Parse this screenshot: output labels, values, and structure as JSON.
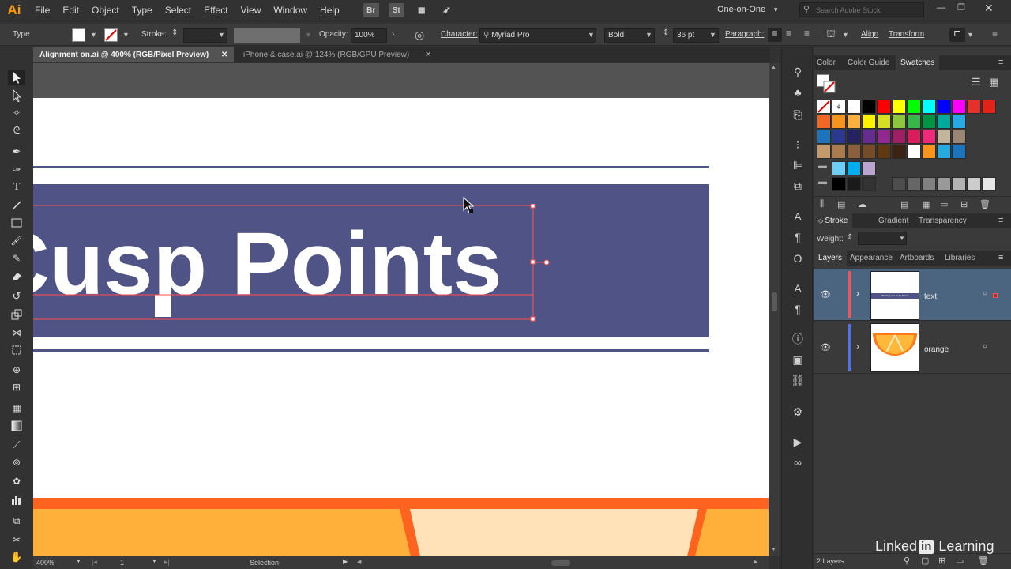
{
  "app": {
    "logo": "Ai"
  },
  "menu": [
    "File",
    "Edit",
    "Object",
    "Type",
    "Select",
    "Effect",
    "View",
    "Window",
    "Help"
  ],
  "menubar_icons": {
    "bridge": "Br",
    "stock": "St"
  },
  "workspace": "One-on-One",
  "stock_search_placeholder": "Search Adobe Stock",
  "control": {
    "type_label": "Type",
    "stroke_label": "Stroke:",
    "opacity_label": "Opacity:",
    "opacity_value": "100%",
    "character_label": "Character:",
    "font_family": "Myriad Pro",
    "font_style": "Bold",
    "font_size": "36 pt",
    "paragraph_label": "Paragraph:",
    "align_label": "Align",
    "transform_label": "Transform"
  },
  "tabs": [
    {
      "label": "Alignment on.ai @ 400% (RGB/Pixel Preview)",
      "active": true
    },
    {
      "label": "iPhone & case.ai @ 124% (RGB/GPU Preview)",
      "active": false
    }
  ],
  "artboard": {
    "headline": "Cusp Points",
    "banner_color": "#505385",
    "orange_outer": "#ff6320",
    "orange_inner": "#ffb03a",
    "orange_light": "#ffe2b8"
  },
  "status": {
    "zoom": "400%",
    "artboard_number": "1",
    "tool": "Selection"
  },
  "color_panel": {
    "tabs": [
      "Color",
      "Color Guide",
      "Swatches"
    ],
    "active_tab": "Swatches",
    "swatch_rows": [
      [
        "#ffffff",
        "#000000",
        "#ff0000",
        "#ffff00",
        "#00ff00",
        "#00ffff",
        "#0000ff",
        "#ff00ff",
        "#e6302c",
        "#e2231a"
      ],
      [
        "#f26522",
        "#f7941d",
        "#fbb040",
        "#fff200",
        "#d7df23",
        "#8dc63f",
        "#39b54a",
        "#009444",
        "#00a99d",
        "#27aae1"
      ],
      [
        "#1c75bc",
        "#2b3990",
        "#262262",
        "#662d91",
        "#92278f",
        "#9e1f63",
        "#da1c5c",
        "#ee2a7b",
        "#c2b59b",
        "#998675"
      ],
      [
        "#c49a6c",
        "#a97c50",
        "#8b5e3c",
        "#754c29",
        "#603913",
        "#3c2415",
        "#ffffff",
        "#f7941d",
        "#27aae1",
        "#1c75bc"
      ],
      [
        "#6dcff6",
        "#00aeef",
        "#b9a5d0"
      ],
      [
        "#000000",
        "#1a1a1a",
        "#333333",
        "#4d4d4d",
        "#666666",
        "#808080",
        "#999999",
        "#b3b3b3",
        "#cccccc",
        "#e6e6e6"
      ]
    ]
  },
  "stroke_panel": {
    "tabs": [
      "Stroke",
      "Gradient",
      "Transparency"
    ],
    "weight_label": "Weight:"
  },
  "layers_panel": {
    "tabs": [
      "Layers",
      "Appearance",
      "Artboards",
      "Libraries"
    ],
    "layers": [
      {
        "name": "text",
        "color": "#ff4f4f",
        "thumb_caption": "Working with Cusp Points"
      },
      {
        "name": "orange",
        "color": "#4f6fff"
      }
    ],
    "count": "2 Layers"
  },
  "watermark": {
    "left": "Linked",
    "box": "in",
    "right": "Learning"
  }
}
